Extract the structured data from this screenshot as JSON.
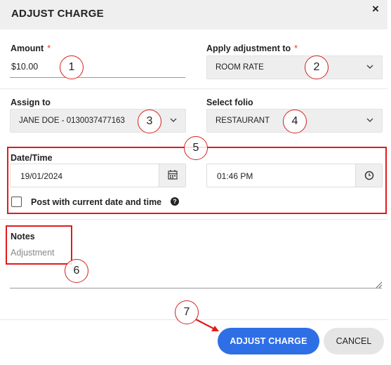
{
  "dialog": {
    "title": "ADJUST CHARGE",
    "close_glyph": "×"
  },
  "amount": {
    "label": "Amount",
    "required_mark": "*",
    "value": "$10.00"
  },
  "apply_adjustment": {
    "label": "Apply adjustment to",
    "required_mark": "*",
    "value": "ROOM RATE"
  },
  "assign_to": {
    "label": "Assign to",
    "value": "JANE DOE - 0130037477163"
  },
  "select_folio": {
    "label": "Select folio",
    "value": "RESTAURANT"
  },
  "datetime": {
    "label": "Date/Time",
    "date": "19/01/2024",
    "time": "01:46 PM",
    "checkbox_label": "Post with current date and time",
    "help_glyph": "?",
    "checkbox_checked": false
  },
  "notes": {
    "label": "Notes",
    "placeholder": "Adjustment"
  },
  "actions": {
    "adjust_label": "ADJUST CHARGE",
    "cancel_label": "CANCEL"
  },
  "callouts": [
    "1",
    "2",
    "3",
    "4",
    "5",
    "6",
    "7"
  ],
  "colors": {
    "annotation": "#e01b1b",
    "primary": "#2f6fe6",
    "required": "#e53935"
  },
  "icons": [
    "close-icon",
    "chevron-down-icon",
    "calendar-icon",
    "clock-icon",
    "help-icon",
    "resize-handle-icon"
  ]
}
